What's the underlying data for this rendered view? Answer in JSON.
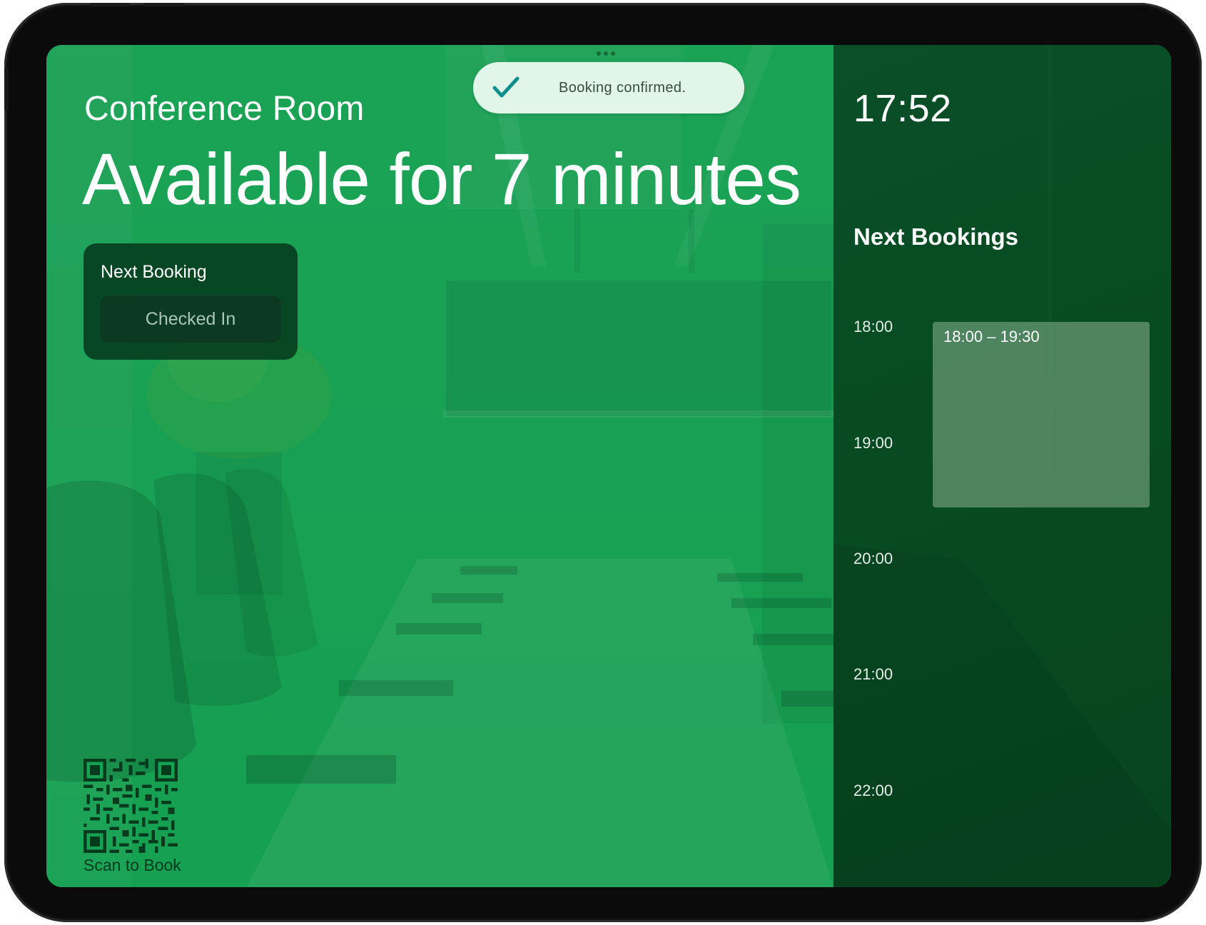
{
  "toast": {
    "message": "Booking confirmed.",
    "icon": "checkmark-icon"
  },
  "room": {
    "name": "Conference Room",
    "status": "Available for 7 minutes"
  },
  "next_booking_card": {
    "title": "Next Booking",
    "action_label": "Checked In"
  },
  "qr": {
    "label": "Scan to Book"
  },
  "sidebar": {
    "clock": "17:52",
    "title": "Next Bookings",
    "hours": [
      "18:00",
      "19:00",
      "20:00",
      "21:00",
      "22:00"
    ],
    "bookings": [
      {
        "time_range": "18:00 – 19:30",
        "start_hour": 18.0,
        "end_hour": 19.5
      }
    ]
  },
  "colors": {
    "available_green": "#16a052",
    "sidebar_dark_green": "#05491f",
    "toast_bg": "#e1f5e8",
    "toast_check": "#0f8f8a"
  }
}
